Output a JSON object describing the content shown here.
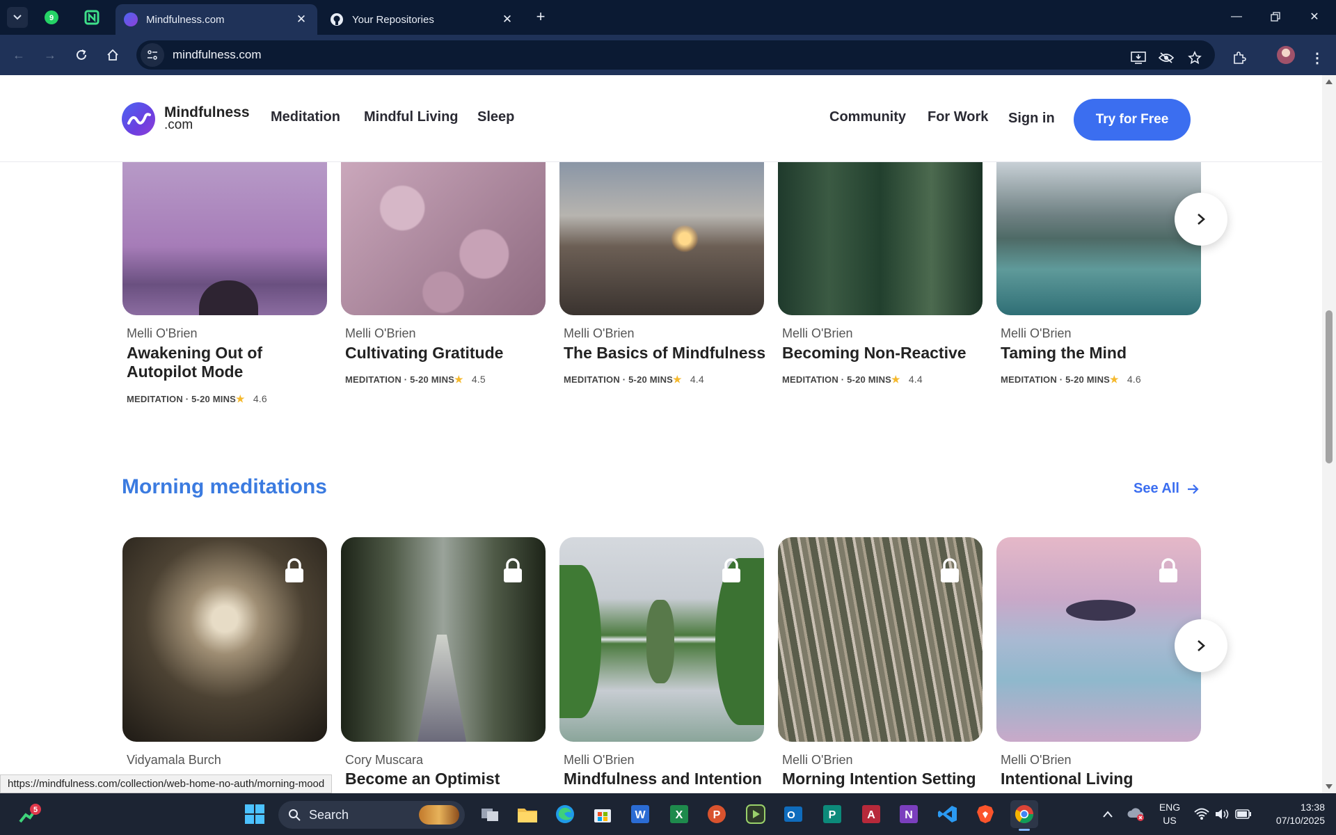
{
  "browser": {
    "tabs": [
      {
        "title": "Mindfulness.com",
        "active": true
      },
      {
        "title": "Your Repositories",
        "active": false
      }
    ],
    "url": "mindfulness.com",
    "status_url": "https://mindfulness.com/collection/web-home-no-auth/morning-mood",
    "pinned_badge": "9"
  },
  "site": {
    "logo_name": "Mindfulness",
    "logo_sub": ".com",
    "nav_left": [
      "Meditation",
      "Mindful Living",
      "Sleep"
    ],
    "nav_right": [
      "Community",
      "For Work",
      "Sign in"
    ],
    "cta_label": "Try for Free"
  },
  "top_row": {
    "cards": [
      {
        "author": "Melli O'Brien",
        "title": "Awakening Out of Autopilot Mode",
        "meta": "MEDITATION · 5-20 MINS",
        "rating": "4.6"
      },
      {
        "author": "Melli O'Brien",
        "title": "Cultivating Gratitude",
        "meta": "MEDITATION · 5-20 MINS",
        "rating": "4.5"
      },
      {
        "author": "Melli O'Brien",
        "title": "The Basics of Mindfulness",
        "meta": "MEDITATION · 5-20 MINS",
        "rating": "4.4"
      },
      {
        "author": "Melli O'Brien",
        "title": "Becoming Non-Reactive",
        "meta": "MEDITATION · 5-20 MINS",
        "rating": "4.4"
      },
      {
        "author": "Melli O'Brien",
        "title": "Taming the Mind",
        "meta": "MEDITATION · 5-20 MINS",
        "rating": "4.6"
      }
    ]
  },
  "morning": {
    "title": "Morning meditations",
    "see_all": "See All",
    "cards": [
      {
        "author": "Vidyamala Burch",
        "title": ""
      },
      {
        "author": "Cory Muscara",
        "title": "Become an Optimist"
      },
      {
        "author": "Melli O'Brien",
        "title": "Mindfulness and Intention"
      },
      {
        "author": "Melli O'Brien",
        "title": "Morning Intention Setting"
      },
      {
        "author": "Melli O'Brien",
        "title": "Intentional Living"
      }
    ]
  },
  "taskbar": {
    "search_label": "Search",
    "notification_badge": "5",
    "lang": "ENG",
    "region": "US",
    "time": "13:38",
    "date": "07/10/2025"
  },
  "colors": {
    "accent_blue": "#3b6ef0",
    "section_title_blue": "#3b7be0",
    "browser_dark": "#0b1a33",
    "browser_toolbar": "#1f3258"
  }
}
